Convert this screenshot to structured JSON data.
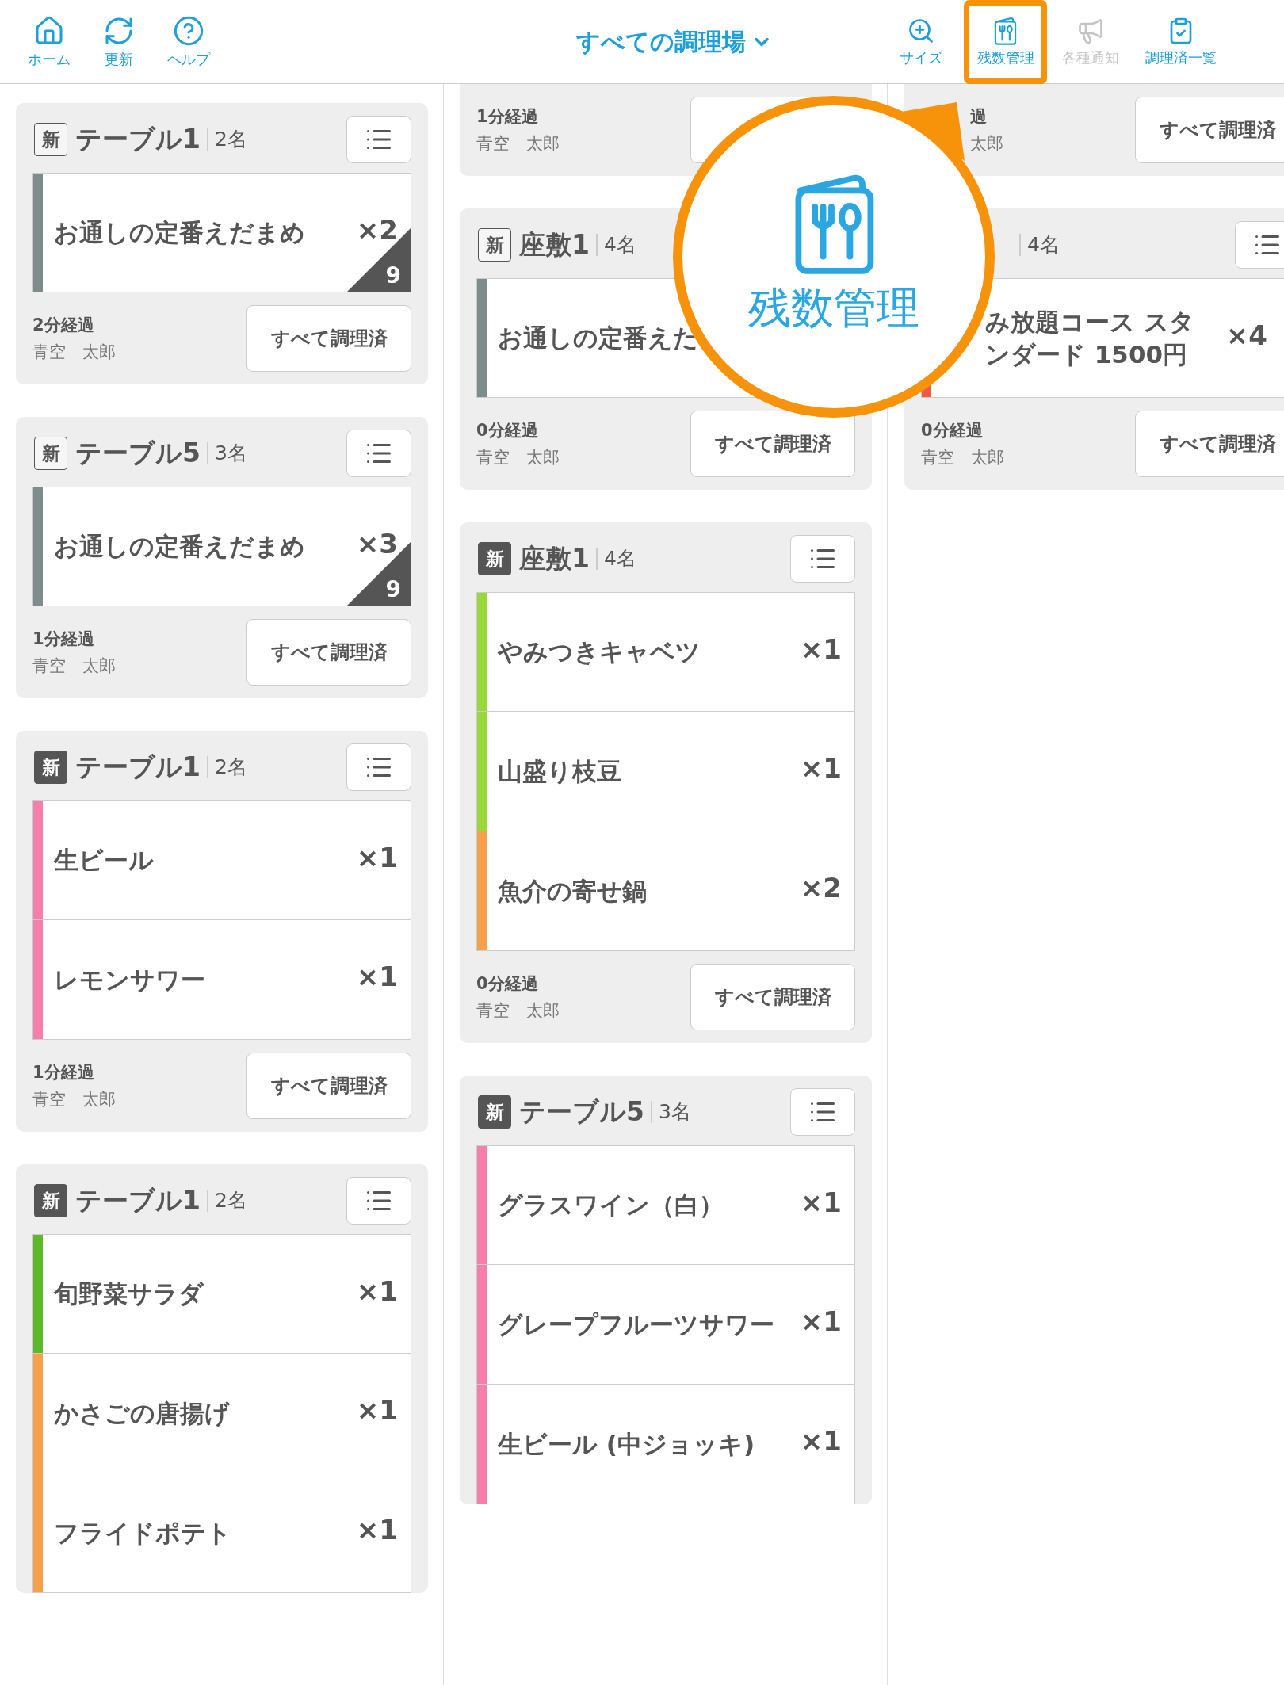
{
  "header": {
    "left_tools": [
      {
        "kind": "home",
        "label": "ホーム"
      },
      {
        "kind": "refresh",
        "label": "更新"
      },
      {
        "kind": "help",
        "label": "ヘルプ"
      }
    ],
    "title": "すべての調理場",
    "right_tools": [
      {
        "kind": "size",
        "label": "サイズ",
        "disabled": false,
        "highlighted": false
      },
      {
        "kind": "stock",
        "label": "残数管理",
        "disabled": false,
        "highlighted": true
      },
      {
        "kind": "notice",
        "label": "各種通知",
        "disabled": true,
        "highlighted": false
      },
      {
        "kind": "done",
        "label": "調理済一覧",
        "disabled": false,
        "highlighted": false
      }
    ]
  },
  "columns": [
    {
      "cards": [
        {
          "header": {
            "badge": "新",
            "badge_filled": false,
            "table": "テーブル1",
            "guests": "2名",
            "menu": true
          },
          "items": [
            {
              "name": "お通しの定番えだまめ",
              "qty": "×2",
              "corner": "9",
              "color": "#7f8c8c"
            }
          ],
          "footer": {
            "elapsed": "2分経過",
            "staff": "青空　太郎",
            "action": "すべて調理済"
          }
        },
        {
          "header": {
            "badge": "新",
            "badge_filled": false,
            "table": "テーブル5",
            "guests": "3名",
            "menu": true
          },
          "items": [
            {
              "name": "お通しの定番えだまめ",
              "qty": "×3",
              "corner": "9",
              "color": "#7f8c8c"
            }
          ],
          "footer": {
            "elapsed": "1分経過",
            "staff": "青空　太郎",
            "action": "すべて調理済"
          }
        },
        {
          "header": {
            "badge": "新",
            "badge_filled": true,
            "table": "テーブル1",
            "guests": "2名",
            "menu": true
          },
          "items": [
            {
              "name": "生ビール",
              "qty": "×1",
              "color": "#f47fab"
            },
            {
              "name": "レモンサワー",
              "qty": "×1",
              "color": "#f47fab"
            }
          ],
          "footer": {
            "elapsed": "1分経過",
            "staff": "青空　太郎",
            "action": "すべて調理済"
          }
        },
        {
          "header": {
            "badge": "新",
            "badge_filled": true,
            "table": "テーブル1",
            "guests": "2名",
            "menu": true
          },
          "items": [
            {
              "name": "旬野菜サラダ",
              "qty": "×1",
              "color": "#5fb82a"
            },
            {
              "name": "かさごの唐揚げ",
              "qty": "×1",
              "color": "#f5a04a"
            },
            {
              "name": "フライドポテト",
              "qty": "×1",
              "color": "#f5a04a"
            }
          ]
        }
      ]
    },
    {
      "cards": [
        {
          "footer": {
            "elapsed": "1分経過",
            "staff": "青空　太郎"
          }
        },
        {
          "header": {
            "badge": "新",
            "badge_filled": false,
            "table": "座敷1",
            "guests": "4名"
          },
          "items": [
            {
              "name": "お通しの定番えだ",
              "color": "#7f8c8c"
            }
          ],
          "footer": {
            "elapsed": "0分経過",
            "staff": "青空　太郎",
            "action": "すべて調理済"
          }
        },
        {
          "header": {
            "badge": "新",
            "badge_filled": true,
            "table": "座敷1",
            "guests": "4名",
            "menu": true
          },
          "items": [
            {
              "name": "やみつきキャベツ",
              "qty": "×1",
              "color": "#99d83a"
            },
            {
              "name": "山盛り枝豆",
              "qty": "×1",
              "color": "#99d83a"
            },
            {
              "name": "魚介の寄せ鍋",
              "qty": "×2",
              "color": "#f5a04a"
            }
          ],
          "footer": {
            "elapsed": "0分経過",
            "staff": "青空　太郎",
            "action": "すべて調理済"
          }
        },
        {
          "header": {
            "badge": "新",
            "badge_filled": true,
            "table": "テーブル5",
            "guests": "3名",
            "menu": true
          },
          "items": [
            {
              "name": "グラスワイン（白）",
              "qty": "×1",
              "color": "#f47fab"
            },
            {
              "name": "グレープフルーツサワー",
              "qty": "×1",
              "color": "#f47fab"
            },
            {
              "name": "生ビール (中ジョッキ)",
              "qty": "×1",
              "color": "#f47fab"
            }
          ]
        }
      ]
    },
    {
      "cards": [
        {
          "footer": {
            "elapsed": "過",
            "staff": "太郎",
            "action": "すべて調理済",
            "covered": true
          }
        },
        {
          "header": {
            "guests": "4名",
            "menu": true,
            "covered": true
          },
          "items": [
            {
              "name": "み放題コース スタンダード 1500円",
              "qty": "×4",
              "color": "#f0584a",
              "covered": true
            }
          ],
          "footer": {
            "elapsed": "0分経過",
            "staff": "青空　太郎",
            "action": "すべて調理済"
          }
        }
      ]
    }
  ],
  "callout": {
    "label": "残数管理"
  }
}
